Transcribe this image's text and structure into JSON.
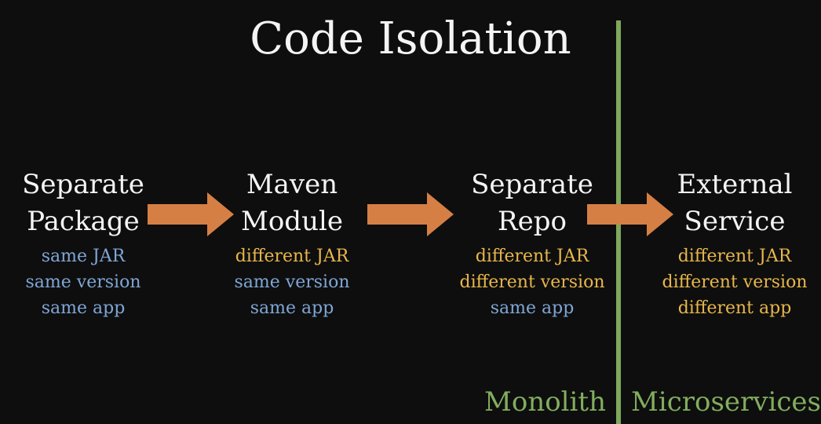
{
  "title": "Code Isolation",
  "colors": {
    "background": "#0e0e0e",
    "title_text": "#f4f4f4",
    "same": "#7fa6d6",
    "different": "#e8b64c",
    "arrow": "#d67f45",
    "divider": "#7ea85b",
    "zone_label": "#82ad5e"
  },
  "stages": [
    {
      "title_line1": "Separate",
      "title_line2": "Package",
      "lines": [
        {
          "text": "same JAR",
          "kind": "same"
        },
        {
          "text": "same version",
          "kind": "same"
        },
        {
          "text": "same app",
          "kind": "same"
        }
      ]
    },
    {
      "title_line1": "Maven",
      "title_line2": "Module",
      "lines": [
        {
          "text": "different JAR",
          "kind": "different"
        },
        {
          "text": "same version",
          "kind": "same"
        },
        {
          "text": "same app",
          "kind": "same"
        }
      ]
    },
    {
      "title_line1": "Separate",
      "title_line2": "Repo",
      "lines": [
        {
          "text": "different JAR",
          "kind": "different"
        },
        {
          "text": "different version",
          "kind": "different"
        },
        {
          "text": "same app",
          "kind": "same"
        }
      ]
    },
    {
      "title_line1": "External",
      "title_line2": "Service",
      "lines": [
        {
          "text": "different JAR",
          "kind": "different"
        },
        {
          "text": "different version",
          "kind": "different"
        },
        {
          "text": "different app",
          "kind": "different"
        }
      ]
    }
  ],
  "zones": {
    "left_label": "Monolith",
    "right_label": "Microservices"
  }
}
